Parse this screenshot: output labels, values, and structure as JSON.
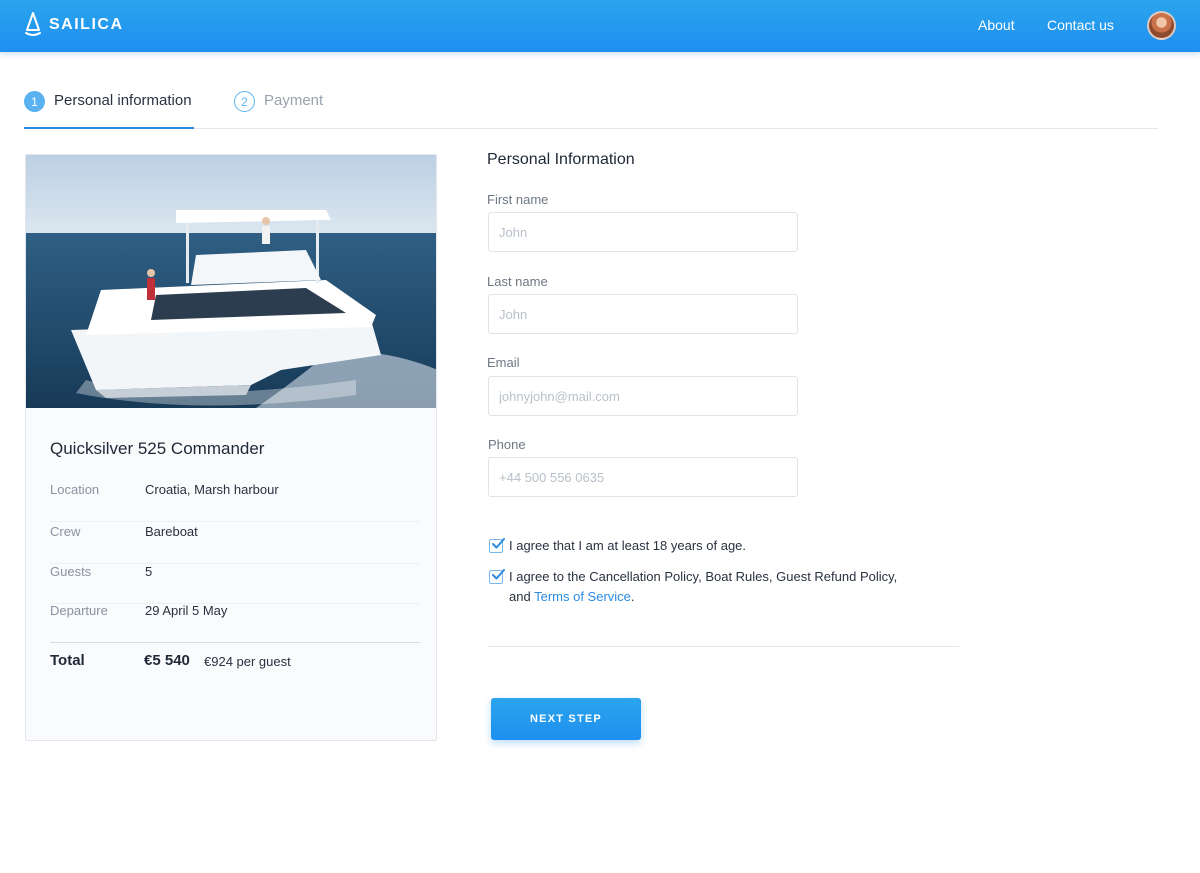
{
  "header": {
    "brand": "SAILICA",
    "logo_icon": "sail-icon",
    "nav": {
      "about": "About",
      "contact": "Contact us"
    },
    "avatar_icon": "user-avatar",
    "accent": "#1f8ff0"
  },
  "tabs": [
    {
      "number": "1",
      "label": "Personal information",
      "active": true
    },
    {
      "number": "2",
      "label": "Payment",
      "active": false
    }
  ],
  "boat": {
    "image": "catamaran-photo",
    "name": "Quicksilver 525 Commander",
    "details": [
      {
        "key": "Location",
        "value": "Croatia, Marsh harbour"
      },
      {
        "key": "Crew",
        "value": "Bareboat"
      },
      {
        "key": "Guests",
        "value": "5"
      },
      {
        "key": "Departure",
        "value": "29 April 5 May"
      }
    ],
    "total_label": "Total",
    "total_value": "€5 540",
    "per_guest": "€924 per guest"
  },
  "form": {
    "title": "Personal Information",
    "fields": {
      "first_name": {
        "label": "First name",
        "placeholder": "John"
      },
      "last_name": {
        "label": "Last name",
        "placeholder": "John"
      },
      "email": {
        "label": "Email",
        "placeholder": "johnyjohn@mail.com"
      },
      "phone": {
        "label": "Phone",
        "placeholder": "+44 500 556 0635"
      }
    },
    "agreements": {
      "age": "I agree that I am at least 18 years of age.",
      "policy_line1": "I agree to the Cancellation Policy, Boat Rules, Guest Refund Policy,",
      "policy_prefix": "and",
      "terms_link": "Terms of Service",
      "policy_suffix": "."
    },
    "next_button": "NEXT STEP"
  }
}
